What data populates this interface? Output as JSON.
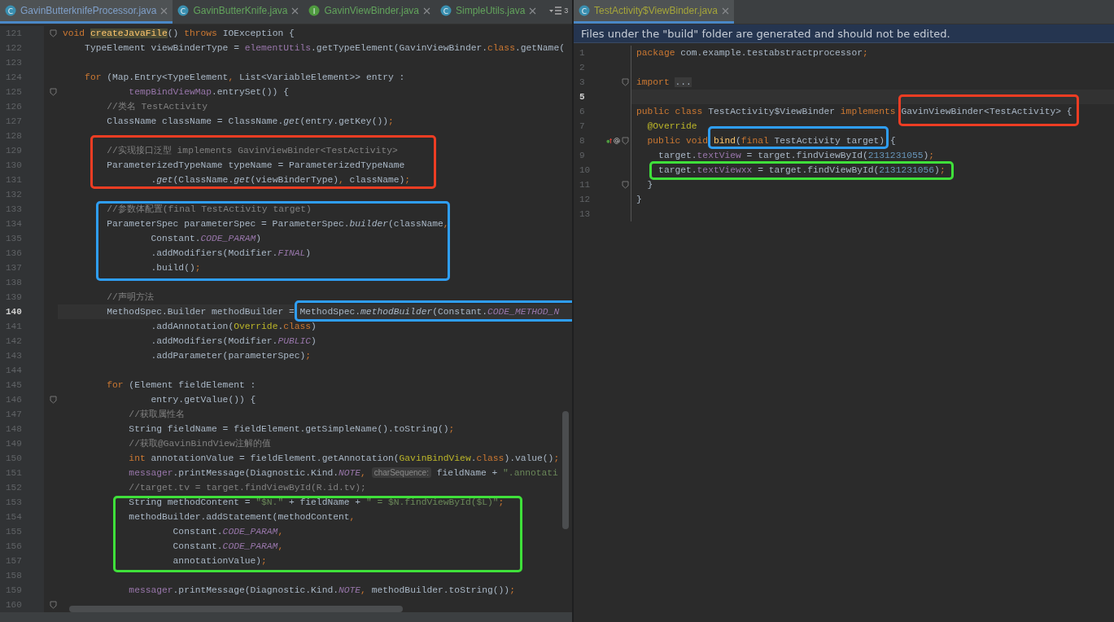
{
  "left_pane": {
    "tabs": [
      {
        "kind": "class",
        "icon_letter": "C",
        "label": "GavinButterknifeProcessor.java",
        "selected": true,
        "color": "#7f9fc8"
      },
      {
        "kind": "class",
        "icon_letter": "C",
        "label": "GavinButterKnife.java",
        "selected": false,
        "color": "#62a35c"
      },
      {
        "kind": "interface",
        "icon_letter": "I",
        "label": "GavinViewBinder.java",
        "selected": false,
        "color": "#62a35c"
      },
      {
        "kind": "class",
        "icon_letter": "C",
        "label": "SimpleUtils.java",
        "selected": false,
        "color": "#62a35c"
      }
    ],
    "overflow_count": "3",
    "lines": [
      {
        "number": "121",
        "fold": true,
        "current": false,
        "tokens": [
          {
            "kind": "keyword",
            "text": "void "
          },
          {
            "kind": "declaration",
            "text": "createJavaFile"
          },
          {
            "kind": "plain",
            "text": "() "
          },
          {
            "kind": "keyword",
            "text": "throws "
          },
          {
            "kind": "plain",
            "text": "IOException {"
          }
        ]
      },
      {
        "number": "122",
        "fold": false,
        "current": false,
        "tokens": [
          {
            "kind": "plain",
            "text": "    TypeElement viewBinderType = "
          },
          {
            "kind": "field",
            "text": "elementUtils"
          },
          {
            "kind": "plain",
            "text": ".getTypeElement(GavinViewBinder."
          },
          {
            "kind": "keyword",
            "text": "class"
          },
          {
            "kind": "plain",
            "text": ".getName("
          }
        ]
      },
      {
        "number": "123",
        "fold": false,
        "current": false
      },
      {
        "number": "124",
        "fold": false,
        "current": false,
        "tokens": [
          {
            "kind": "keyword",
            "text": "    for "
          },
          {
            "kind": "plain",
            "text": "(Map.Entry<TypeElement"
          },
          {
            "kind": "keyword",
            "text": ", "
          },
          {
            "kind": "plain",
            "text": "List<VariableElement>> entry :"
          }
        ]
      },
      {
        "number": "125",
        "fold": true,
        "current": false,
        "tokens": [
          {
            "kind": "field",
            "text": "            tempBindViewMap"
          },
          {
            "kind": "plain",
            "text": ".entrySet()) {"
          }
        ]
      },
      {
        "number": "126",
        "fold": false,
        "current": false,
        "tokens": [
          {
            "kind": "comment",
            "text": "        //类名 TestActivity"
          }
        ]
      },
      {
        "number": "127",
        "fold": false,
        "current": false,
        "tokens": [
          {
            "kind": "plain",
            "text": "        ClassName className = ClassName."
          },
          {
            "kind": "call",
            "text": "get"
          },
          {
            "kind": "plain",
            "text": "(entry.getKey())"
          },
          {
            "kind": "keyword",
            "text": ";"
          }
        ]
      },
      {
        "number": "128",
        "fold": false,
        "current": false
      },
      {
        "number": "129",
        "fold": false,
        "current": false,
        "tokens": [
          {
            "kind": "comment",
            "text": "        //实现接口泛型 implements GavinViewBinder<TestActivity>"
          }
        ]
      },
      {
        "number": "130",
        "fold": false,
        "current": false,
        "tokens": [
          {
            "kind": "plain",
            "text": "        ParameterizedTypeName typeName = ParameterizedTypeName"
          }
        ]
      },
      {
        "number": "131",
        "fold": false,
        "current": false,
        "tokens": [
          {
            "kind": "plain",
            "text": "                ."
          },
          {
            "kind": "call",
            "text": "get"
          },
          {
            "kind": "plain",
            "text": "(ClassName."
          },
          {
            "kind": "call",
            "text": "get"
          },
          {
            "kind": "plain",
            "text": "(viewBinderType)"
          },
          {
            "kind": "keyword",
            "text": ", "
          },
          {
            "kind": "plain",
            "text": "className)"
          },
          {
            "kind": "keyword",
            "text": ";"
          }
        ]
      },
      {
        "number": "132",
        "fold": false,
        "current": false
      },
      {
        "number": "133",
        "fold": false,
        "current": false,
        "tokens": [
          {
            "kind": "comment",
            "text": "        //参数体配置(final TestActivity target)"
          }
        ]
      },
      {
        "number": "134",
        "fold": false,
        "current": false,
        "tokens": [
          {
            "kind": "plain",
            "text": "        ParameterSpec parameterSpec = ParameterSpec."
          },
          {
            "kind": "call",
            "text": "builder"
          },
          {
            "kind": "plain",
            "text": "(className"
          },
          {
            "kind": "keyword",
            "text": ","
          }
        ]
      },
      {
        "number": "135",
        "fold": false,
        "current": false,
        "tokens": [
          {
            "kind": "plain",
            "text": "                Constant."
          },
          {
            "kind": "constant",
            "text": "CODE_PARAM"
          },
          {
            "kind": "plain",
            "text": ")"
          }
        ]
      },
      {
        "number": "136",
        "fold": false,
        "current": false,
        "tokens": [
          {
            "kind": "plain",
            "text": "                .addModifiers(Modifier."
          },
          {
            "kind": "constant",
            "text": "FINAL"
          },
          {
            "kind": "plain",
            "text": ")"
          }
        ]
      },
      {
        "number": "137",
        "fold": false,
        "current": false,
        "tokens": [
          {
            "kind": "plain",
            "text": "                .build()"
          },
          {
            "kind": "keyword",
            "text": ";"
          }
        ]
      },
      {
        "number": "138",
        "fold": false,
        "current": false
      },
      {
        "number": "139",
        "fold": false,
        "current": false,
        "tokens": [
          {
            "kind": "comment",
            "text": "        //声明方法"
          }
        ]
      },
      {
        "number": "140",
        "fold": false,
        "current": true,
        "tokens": [
          {
            "kind": "plain",
            "text": "        MethodSpec.Builder methodBuilder = MethodSpec."
          },
          {
            "kind": "call",
            "text": "methodBuilder"
          },
          {
            "kind": "plain",
            "text": "(Constant."
          },
          {
            "kind": "constant",
            "text": "CODE_METHOD_N"
          }
        ]
      },
      {
        "number": "141",
        "fold": false,
        "current": false,
        "tokens": [
          {
            "kind": "plain",
            "text": "                .addAnnotation("
          },
          {
            "kind": "annotation",
            "text": "Override"
          },
          {
            "kind": "plain",
            "text": "."
          },
          {
            "kind": "keyword",
            "text": "class"
          },
          {
            "kind": "plain",
            "text": ")"
          }
        ]
      },
      {
        "number": "142",
        "fold": false,
        "current": false,
        "tokens": [
          {
            "kind": "plain",
            "text": "                .addModifiers(Modifier."
          },
          {
            "kind": "constant",
            "text": "PUBLIC"
          },
          {
            "kind": "plain",
            "text": ")"
          }
        ]
      },
      {
        "number": "143",
        "fold": false,
        "current": false,
        "tokens": [
          {
            "kind": "plain",
            "text": "                .addParameter(parameterSpec)"
          },
          {
            "kind": "keyword",
            "text": ";"
          }
        ]
      },
      {
        "number": "144",
        "fold": false,
        "current": false
      },
      {
        "number": "145",
        "fold": false,
        "current": false,
        "tokens": [
          {
            "kind": "keyword",
            "text": "        for "
          },
          {
            "kind": "plain",
            "text": "(Element fieldElement :"
          }
        ]
      },
      {
        "number": "146",
        "fold": true,
        "current": false,
        "tokens": [
          {
            "kind": "plain",
            "text": "                entry.getValue()) {"
          }
        ]
      },
      {
        "number": "147",
        "fold": false,
        "current": false,
        "tokens": [
          {
            "kind": "comment",
            "text": "            //获取属性名"
          }
        ]
      },
      {
        "number": "148",
        "fold": false,
        "current": false,
        "tokens": [
          {
            "kind": "plain",
            "text": "            String fieldName = fieldElement.getSimpleName().toString()"
          },
          {
            "kind": "keyword",
            "text": ";"
          }
        ]
      },
      {
        "number": "149",
        "fold": false,
        "current": false,
        "tokens": [
          {
            "kind": "comment",
            "text": "            //获取@GavinBindView注解的值"
          }
        ]
      },
      {
        "number": "150",
        "fold": false,
        "current": false,
        "tokens": [
          {
            "kind": "keyword",
            "text": "            int "
          },
          {
            "kind": "plain",
            "text": "annotationValue = fieldElement.getAnnotation("
          },
          {
            "kind": "annotation",
            "text": "GavinBindView"
          },
          {
            "kind": "plain",
            "text": "."
          },
          {
            "kind": "keyword",
            "text": "class"
          },
          {
            "kind": "plain",
            "text": ").value()"
          },
          {
            "kind": "keyword",
            "text": ";"
          }
        ]
      },
      {
        "number": "151",
        "fold": false,
        "current": false,
        "tokens": [
          {
            "kind": "field",
            "text": "            messager"
          },
          {
            "kind": "plain",
            "text": ".printMessage(Diagnostic.Kind."
          },
          {
            "kind": "constant",
            "text": "NOTE"
          },
          {
            "kind": "keyword",
            "text": ", "
          },
          {
            "kind": "hint",
            "text": "charSequence:"
          },
          {
            "kind": "plain",
            "text": " fieldName + "
          },
          {
            "kind": "string",
            "text": "\".annotati"
          }
        ]
      },
      {
        "number": "152",
        "fold": false,
        "current": false,
        "tokens": [
          {
            "kind": "comment",
            "text": "            //target.tv = target.findViewById(R.id.tv);"
          }
        ]
      },
      {
        "number": "153",
        "fold": false,
        "current": false,
        "tokens": [
          {
            "kind": "plain",
            "text": "            String methodContent = "
          },
          {
            "kind": "string",
            "text": "\"$N.\""
          },
          {
            "kind": "plain",
            "text": " + fieldName + "
          },
          {
            "kind": "string",
            "text": "\" = $N.findViewById($L)\""
          },
          {
            "kind": "keyword",
            "text": ";"
          }
        ]
      },
      {
        "number": "154",
        "fold": false,
        "current": false,
        "tokens": [
          {
            "kind": "plain",
            "text": "            methodBuilder.addStatement(methodContent"
          },
          {
            "kind": "keyword",
            "text": ","
          }
        ]
      },
      {
        "number": "155",
        "fold": false,
        "current": false,
        "tokens": [
          {
            "kind": "plain",
            "text": "                    Constant."
          },
          {
            "kind": "constant",
            "text": "CODE_PARAM"
          },
          {
            "kind": "keyword",
            "text": ","
          }
        ]
      },
      {
        "number": "156",
        "fold": false,
        "current": false,
        "tokens": [
          {
            "kind": "plain",
            "text": "                    Constant."
          },
          {
            "kind": "constant",
            "text": "CODE_PARAM"
          },
          {
            "kind": "keyword",
            "text": ","
          }
        ]
      },
      {
        "number": "157",
        "fold": false,
        "current": false,
        "tokens": [
          {
            "kind": "plain",
            "text": "                    annotationValue)"
          },
          {
            "kind": "keyword",
            "text": ";"
          }
        ]
      },
      {
        "number": "158",
        "fold": false,
        "current": false
      },
      {
        "number": "159",
        "fold": false,
        "current": false,
        "tokens": [
          {
            "kind": "field",
            "text": "            messager"
          },
          {
            "kind": "plain",
            "text": ".printMessage(Diagnostic.Kind."
          },
          {
            "kind": "constant",
            "text": "NOTE"
          },
          {
            "kind": "keyword",
            "text": ", "
          },
          {
            "kind": "plain",
            "text": "methodBuilder.toString())"
          },
          {
            "kind": "keyword",
            "text": ";"
          }
        ]
      },
      {
        "number": "160",
        "fold": true,
        "current": false
      }
    ],
    "highlights": [
      {
        "color": "#ee3d23"
      },
      {
        "color": "#2f9ef5"
      },
      {
        "color": "#2f9ef5"
      },
      {
        "color": "#3fe03a"
      }
    ]
  },
  "right_pane": {
    "tabs": [
      {
        "kind": "class",
        "icon_letter": "C",
        "label": "TestActivity$ViewBinder.java",
        "selected": true,
        "color": "#a5a53a"
      }
    ],
    "banner": "Files under the \"build\" folder are generated and should not be edited.",
    "lines": [
      {
        "number": "1",
        "fold": false,
        "current": false,
        "override_marker": false,
        "tokens": [
          {
            "kind": "keyword",
            "text": "package "
          },
          {
            "kind": "plain",
            "text": "com.example.testabstractprocessor"
          },
          {
            "kind": "keyword",
            "text": ";"
          }
        ]
      },
      {
        "number": "2",
        "fold": false,
        "current": false,
        "override_marker": false
      },
      {
        "number": "3",
        "fold": true,
        "current": false,
        "override_marker": false,
        "tokens": [
          {
            "kind": "keyword",
            "text": "import "
          },
          {
            "kind": "folded",
            "text": "..."
          }
        ]
      },
      {
        "number": "5",
        "fold": false,
        "current": true,
        "override_marker": false
      },
      {
        "number": "6",
        "fold": false,
        "current": false,
        "override_marker": false,
        "tokens": [
          {
            "kind": "keyword",
            "text": "public class "
          },
          {
            "kind": "plain",
            "text": "TestActivity$ViewBinder "
          },
          {
            "kind": "keyword",
            "text": "implements "
          },
          {
            "kind": "plain",
            "text": "GavinViewBinder<TestActivity> {"
          }
        ]
      },
      {
        "number": "7",
        "fold": false,
        "current": false,
        "override_marker": false,
        "tokens": [
          {
            "kind": "annotation",
            "text": "  @Override"
          }
        ]
      },
      {
        "number": "8",
        "fold": true,
        "current": false,
        "override_marker": true,
        "tokens": [
          {
            "kind": "keyword",
            "text": "  public void "
          },
          {
            "kind": "method",
            "text": "bind"
          },
          {
            "kind": "plain",
            "text": "("
          },
          {
            "kind": "keyword",
            "text": "final "
          },
          {
            "kind": "plain",
            "text": "TestActivity target) {"
          }
        ]
      },
      {
        "number": "9",
        "fold": false,
        "current": false,
        "override_marker": false,
        "tokens": [
          {
            "kind": "plain",
            "text": "    target."
          },
          {
            "kind": "field",
            "text": "textView"
          },
          {
            "kind": "plain",
            "text": " = target.findViewById("
          },
          {
            "kind": "number",
            "text": "2131231055"
          },
          {
            "kind": "plain",
            "text": ")"
          },
          {
            "kind": "keyword",
            "text": ";"
          }
        ]
      },
      {
        "number": "10",
        "fold": false,
        "current": false,
        "override_marker": false,
        "tokens": [
          {
            "kind": "plain",
            "text": "    target."
          },
          {
            "kind": "field",
            "text": "textViewxx"
          },
          {
            "kind": "plain",
            "text": " = target.findViewById("
          },
          {
            "kind": "number",
            "text": "2131231056"
          },
          {
            "kind": "plain",
            "text": ")"
          },
          {
            "kind": "keyword",
            "text": ";"
          }
        ]
      },
      {
        "number": "11",
        "fold": true,
        "current": false,
        "override_marker": false,
        "tokens": [
          {
            "kind": "plain",
            "text": "  }"
          }
        ]
      },
      {
        "number": "12",
        "fold": false,
        "current": false,
        "override_marker": false,
        "tokens": [
          {
            "kind": "plain",
            "text": "}"
          }
        ]
      },
      {
        "number": "13",
        "fold": false,
        "current": false,
        "override_marker": false
      }
    ],
    "highlights": [
      {
        "color": "#ee3d23"
      },
      {
        "color": "#2f9ef5"
      },
      {
        "color": "#3fe03a"
      }
    ]
  }
}
